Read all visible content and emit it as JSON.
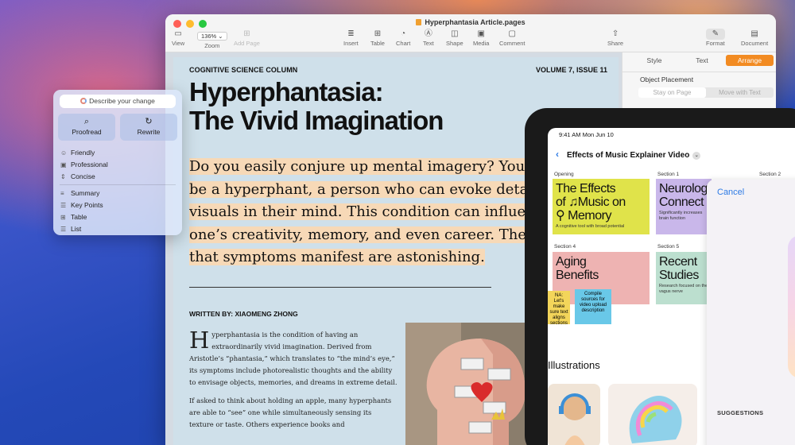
{
  "window": {
    "title": "Hyperphantasia Article.pages",
    "toolbar": {
      "view": "View",
      "zoom_value": "136%",
      "zoom": "Zoom",
      "add_page": "Add Page",
      "insert": "Insert",
      "table": "Table",
      "chart": "Chart",
      "text": "Text",
      "shape": "Shape",
      "media": "Media",
      "comment": "Comment",
      "share": "Share",
      "format": "Format",
      "document": "Document"
    }
  },
  "article": {
    "kicker": "COGNITIVE SCIENCE COLUMN",
    "volume": "VOLUME 7, ISSUE 11",
    "headline": "Hyperphantasia:\nThe Vivid Imagination",
    "lead_lines": [
      "Do you easily conjure up mental imagery? You",
      "be a hyperphant, a person who can evoke detailed",
      "visuals in their mind. This condition can influence",
      "one’s creativity, memory, and even career. The ways",
      "that symptoms manifest are astonishing."
    ],
    "byline": "WRITTEN BY: XIAOMENG ZHONG",
    "drop_cap": "H",
    "para1": "yperphantasia is the condition of having an extraordinarily vivid imagination. Derived from Aristotle’s “phantasia,” which translates to “the mind’s eye,” its symptoms include photorealistic thoughts and the ability to envisage objects, memories, and dreams in extreme detail.",
    "para2": "If asked to think about holding an apple, many hyperphants are able to “see” one while simultaneously sensing its texture or taste. Others experience books and"
  },
  "sidebar": {
    "tabs": [
      "Style",
      "Text",
      "Arrange"
    ],
    "active_tab": "Arrange",
    "object_placement_label": "Object Placement",
    "placement_options": [
      "Stay on Page",
      "Move with Text"
    ]
  },
  "writing_tools": {
    "describe": "Describe your change",
    "proofread": "Proofread",
    "rewrite": "Rewrite",
    "tones": [
      "Friendly",
      "Professional",
      "Concise"
    ],
    "formats": [
      "Summary",
      "Key Points",
      "Table",
      "List"
    ]
  },
  "ipad": {
    "time": "9:41 AM  Mon Jun 10",
    "board_title": "Effects of Music Explainer Video",
    "sections": [
      "Opening",
      "Section 1",
      "Section 2",
      "Section 4",
      "Section 5"
    ],
    "cards": {
      "effects_title": "The Effects\nof ♫Music on\n⚲ Memory",
      "effects_sub": "A cognitive tool with broad potential",
      "neuro_title": "Neurolog\nConnect",
      "neuro_sub": "Significantly increases brain function",
      "aging_title": "Aging\nBenefits",
      "recent_title": "Recent\nStudies",
      "recent_sub": "Research focused on the vagus nerve"
    },
    "stickies": [
      "NA: Let's make sure text aligns sections",
      "Compile sources for video upload description"
    ],
    "illustrations": "Illustrations",
    "cancel": "Cancel",
    "suggestions": "SUGGESTIONS"
  }
}
